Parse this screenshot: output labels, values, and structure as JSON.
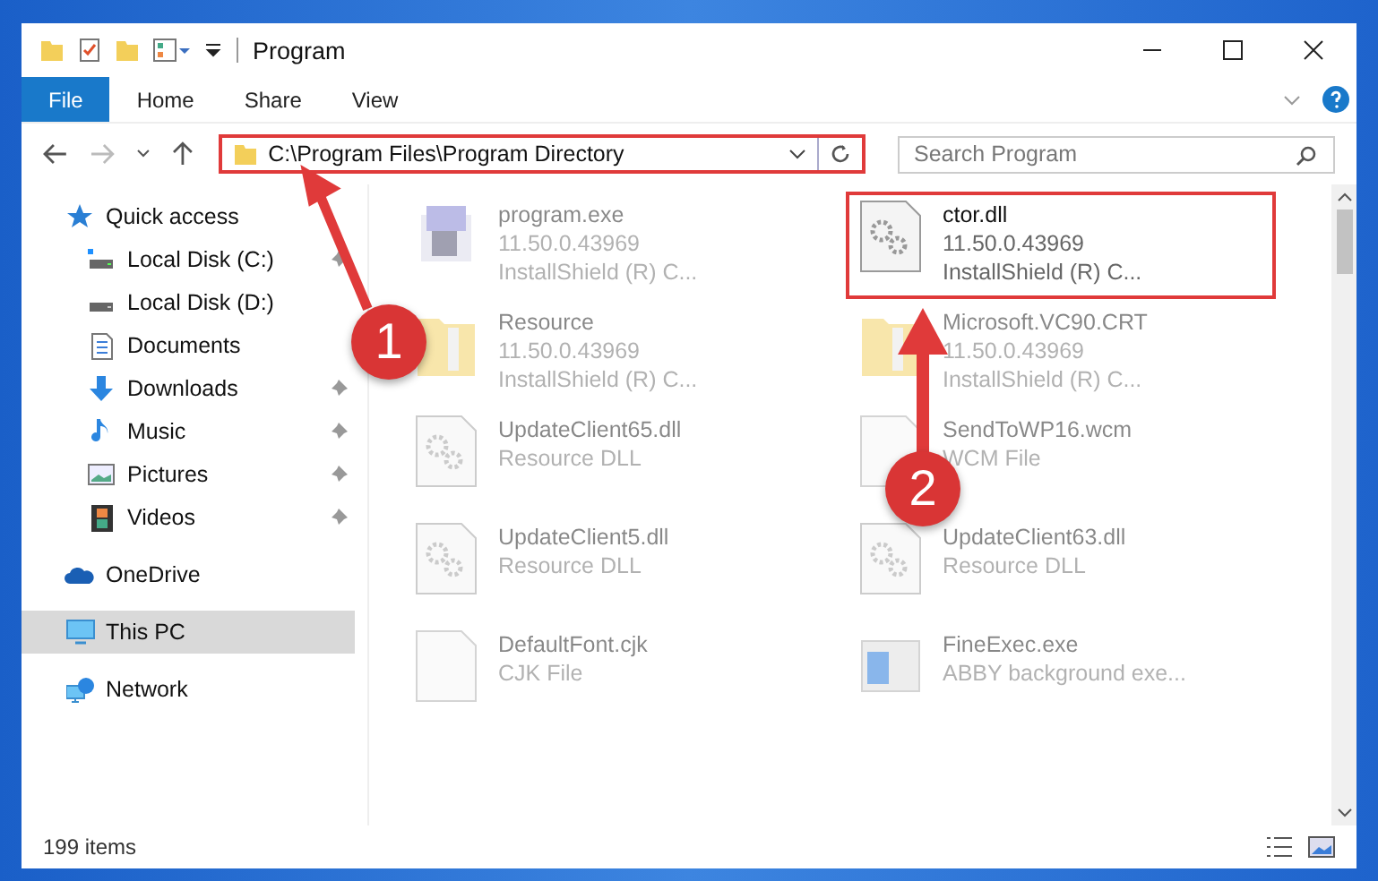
{
  "window": {
    "title": "Program"
  },
  "ribbon_tabs": [
    {
      "label": "File",
      "kind": "file"
    },
    {
      "label": "Home",
      "kind": "tab"
    },
    {
      "label": "Share",
      "kind": "tab"
    },
    {
      "label": "View",
      "kind": "tab"
    }
  ],
  "address": {
    "path": "C:\\Program Files\\Program Directory",
    "highlighted": true
  },
  "search": {
    "placeholder": "Search Program"
  },
  "sidebar": {
    "items": [
      {
        "label": "Quick access",
        "kind": "header",
        "pinned": false,
        "selected": false
      },
      {
        "label": "Local Disk (C:)",
        "kind": "item",
        "pinned": true,
        "selected": false
      },
      {
        "label": "Local Disk (D:)",
        "kind": "item",
        "pinned": false,
        "selected": false
      },
      {
        "label": "Documents",
        "kind": "item",
        "pinned": false,
        "selected": false
      },
      {
        "label": "Downloads",
        "kind": "item",
        "pinned": true,
        "selected": false
      },
      {
        "label": "Music",
        "kind": "item",
        "pinned": true,
        "selected": false
      },
      {
        "label": "Pictures",
        "kind": "item",
        "pinned": true,
        "selected": false
      },
      {
        "label": "Videos",
        "kind": "item",
        "pinned": true,
        "selected": false
      },
      {
        "label": "OneDrive",
        "kind": "header",
        "pinned": false,
        "selected": false
      },
      {
        "label": "This PC",
        "kind": "header",
        "pinned": false,
        "selected": true
      },
      {
        "label": "Network",
        "kind": "header",
        "pinned": false,
        "selected": false
      }
    ]
  },
  "files": [
    {
      "name": "program.exe",
      "lines": [
        "11.50.0.43969",
        "InstallShield (R) C..."
      ],
      "kind": "exe",
      "highlighted": false,
      "blurred": true
    },
    {
      "name": "ctor.dll",
      "lines": [
        "11.50.0.43969",
        "InstallShield (R) C..."
      ],
      "kind": "dll",
      "highlighted": true,
      "blurred": false
    },
    {
      "name": "Resource",
      "lines": [
        "11.50.0.43969",
        "InstallShield (R) C..."
      ],
      "kind": "folder",
      "highlighted": false,
      "blurred": true
    },
    {
      "name": "Microsoft.VC90.CRT",
      "lines": [
        "11.50.0.43969",
        "InstallShield (R) C..."
      ],
      "kind": "folder",
      "highlighted": false,
      "blurred": true
    },
    {
      "name": "UpdateClient65.dll",
      "lines": [
        "Resource DLL"
      ],
      "kind": "dll",
      "highlighted": false,
      "blurred": true
    },
    {
      "name": "SendToWP16.wcm",
      "lines": [
        "WCM File"
      ],
      "kind": "file",
      "highlighted": false,
      "blurred": true
    },
    {
      "name": "UpdateClient5.dll",
      "lines": [
        "Resource DLL"
      ],
      "kind": "dll",
      "highlighted": false,
      "blurred": true
    },
    {
      "name": "UpdateClient63.dll",
      "lines": [
        "Resource DLL"
      ],
      "kind": "dll",
      "highlighted": false,
      "blurred": true
    },
    {
      "name": "DefaultFont.cjk",
      "lines": [
        "CJK File"
      ],
      "kind": "file",
      "highlighted": false,
      "blurred": true
    },
    {
      "name": "FineExec.exe",
      "lines": [
        "ABBY background exe..."
      ],
      "kind": "app",
      "highlighted": false,
      "blurred": true
    }
  ],
  "status_bar": {
    "item_count": "199 items"
  },
  "annotations": [
    {
      "number": "1",
      "kind": "diagonal"
    },
    {
      "number": "2",
      "kind": "vertical"
    }
  ]
}
